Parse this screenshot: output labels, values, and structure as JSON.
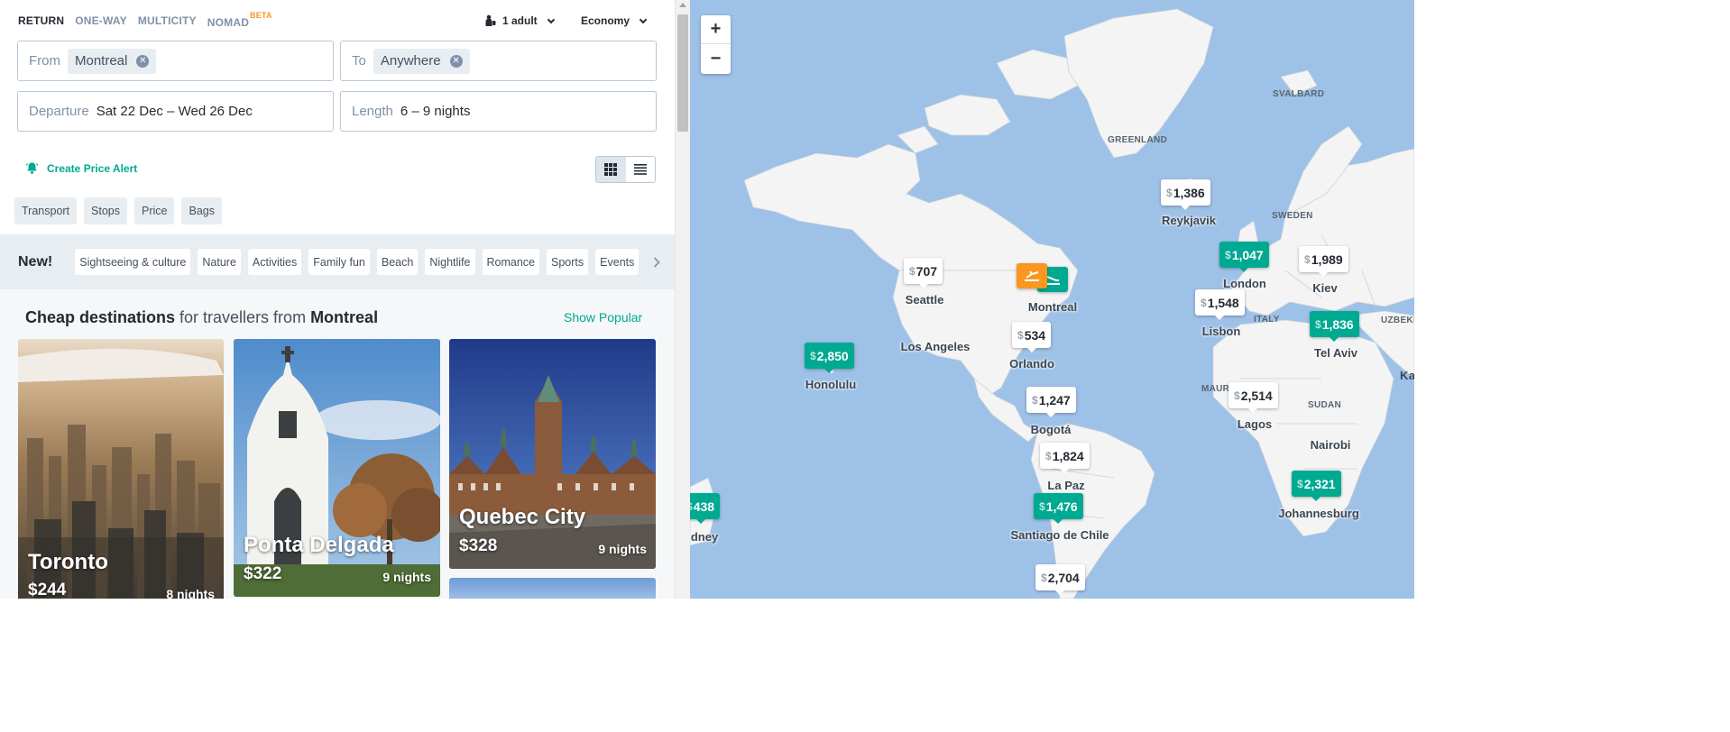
{
  "trip_types": [
    {
      "label": "RETURN",
      "active": true
    },
    {
      "label": "ONE-WAY",
      "active": false
    },
    {
      "label": "MULTICITY",
      "active": false
    },
    {
      "label": "NOMAD",
      "active": false,
      "badge": "BETA"
    }
  ],
  "passengers": {
    "label": "1 adult"
  },
  "cabin": {
    "label": "Economy"
  },
  "search": {
    "from_label": "From",
    "from_value": "Montreal",
    "to_label": "To",
    "to_value": "Anywhere",
    "departure_label": "Departure",
    "departure_value": "Sat 22 Dec – Wed 26 Dec",
    "length_label": "Length",
    "length_value": "6 – 9 nights"
  },
  "price_alert": {
    "label": "Create Price Alert"
  },
  "filters": [
    "Transport",
    "Stops",
    "Price",
    "Bags"
  ],
  "themes": {
    "new_label": "New!",
    "items": [
      "Sightseeing & culture",
      "Nature",
      "Activities",
      "Family fun",
      "Beach",
      "Nightlife",
      "Romance",
      "Sports",
      "Events"
    ]
  },
  "results": {
    "heading_bold": "Cheap destinations",
    "heading_mid": " for travellers from ",
    "heading_city": "Montreal",
    "show_popular": "Show Popular",
    "cards": [
      {
        "city": "Toronto",
        "price": "$244",
        "nights": "8 nights"
      },
      {
        "city": "Ponta Delgada",
        "price": "$322",
        "nights": "9 nights"
      },
      {
        "city": "Quebec City",
        "price": "$328",
        "nights": "9 nights"
      }
    ]
  },
  "map": {
    "zoom_in": "+",
    "zoom_out": "−",
    "pins": [
      {
        "price": "1,386",
        "highlight": false
      },
      {
        "price": "707",
        "highlight": false
      },
      {
        "price": "1,047",
        "highlight": true
      },
      {
        "price": "1,989",
        "highlight": false
      },
      {
        "price": "1,548",
        "highlight": false
      },
      {
        "price": "1,836",
        "highlight": true
      },
      {
        "price": "534",
        "highlight": false
      },
      {
        "price": "2,850",
        "highlight": true
      },
      {
        "price": "1,247",
        "highlight": false
      },
      {
        "price": "2,514",
        "highlight": false
      },
      {
        "price": "1,824",
        "highlight": false
      },
      {
        "price": "1,476",
        "highlight": true
      },
      {
        "price": "2,321",
        "highlight": true
      },
      {
        "price": "438",
        "highlight": true
      },
      {
        "price": "2,704",
        "highlight": false
      }
    ],
    "cities": [
      "Reykjavik",
      "Seattle",
      "London",
      "Kiev",
      "Montreal",
      "Lisbon",
      "Tel Aviv",
      "Los Angeles",
      "Orlando",
      "Honolulu",
      "Bogotá",
      "Lagos",
      "Nairobi",
      "La Paz",
      "Santiago de Chile",
      "Johannesburg",
      "dney"
    ],
    "regions": [
      "SVALBARD",
      "GREENLAND",
      "SWEDEN",
      "ITALY",
      "UZBEKI",
      "MAURITA",
      "SUDAN",
      "Ka"
    ],
    "colors": {
      "water": "#9ec1e7",
      "land": "#f4f4f4",
      "accent": "#00a991",
      "origin": "#f9971e"
    }
  }
}
